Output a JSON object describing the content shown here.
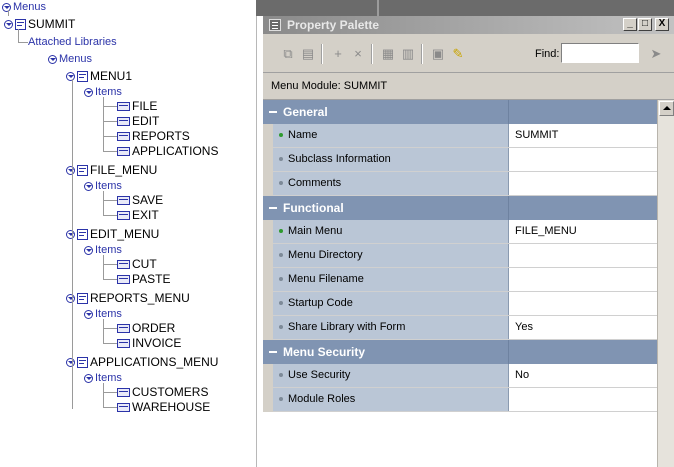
{
  "tree": {
    "root": "Menus",
    "module": "SUMMIT",
    "attached_libraries": "Attached Libraries",
    "menus_label": "Menus",
    "items_label": "Items",
    "menus": [
      {
        "name": "MENU1",
        "items": [
          "FILE",
          "EDIT",
          "REPORTS",
          "APPLICATIONS"
        ]
      },
      {
        "name": "FILE_MENU",
        "items": [
          "SAVE",
          "EXIT"
        ]
      },
      {
        "name": "EDIT_MENU",
        "items": [
          "CUT",
          "PASTE"
        ]
      },
      {
        "name": "REPORTS_MENU",
        "items": [
          "ORDER",
          "INVOICE"
        ]
      },
      {
        "name": "APPLICATIONS_MENU",
        "items": [
          "CUSTOMERS",
          "WAREHOUSE"
        ]
      }
    ]
  },
  "palette": {
    "title": "Property Palette",
    "window_controls": {
      "minimize": "_",
      "maximize": "□",
      "close": "X"
    },
    "find_label": "Find:",
    "find_value": "",
    "module_line": "Menu Module: SUMMIT",
    "categories": [
      {
        "name": "General",
        "properties": [
          {
            "name": "Name",
            "value": "SUMMIT",
            "set": true
          },
          {
            "name": "Subclass Information",
            "value": "",
            "set": false
          },
          {
            "name": "Comments",
            "value": "",
            "set": false
          }
        ]
      },
      {
        "name": "Functional",
        "properties": [
          {
            "name": "Main Menu",
            "value": "FILE_MENU",
            "set": true
          },
          {
            "name": "Menu Directory",
            "value": "",
            "set": false
          },
          {
            "name": "Menu Filename",
            "value": "",
            "set": false
          },
          {
            "name": "Startup Code",
            "value": "",
            "set": false
          },
          {
            "name": "Share Library with Form",
            "value": "Yes",
            "set": false
          }
        ]
      },
      {
        "name": "Menu Security",
        "properties": [
          {
            "name": "Use Security",
            "value": "No",
            "set": false
          },
          {
            "name": "Module Roles",
            "value": "",
            "set": false
          }
        ]
      }
    ]
  },
  "colors": {
    "tree_text": "#2b33a8",
    "category_bg": "#8094b2",
    "property_name_bg": "#bac6d6",
    "window_bg": "#d4d0c8"
  },
  "icons": {
    "toolbar": [
      "copy-icon",
      "paste-icon",
      "add-icon",
      "delete-icon",
      "expand-icon",
      "collapse-icon",
      "property-class-icon",
      "pin-icon",
      "find-next-icon"
    ]
  }
}
